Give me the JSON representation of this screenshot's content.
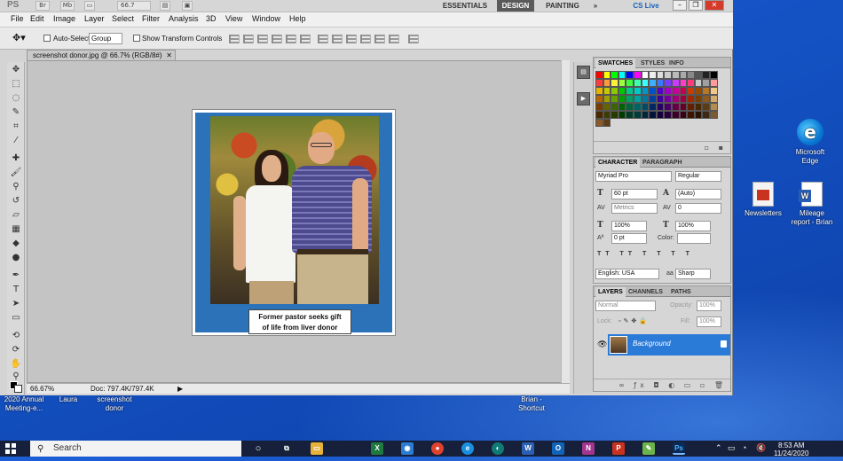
{
  "app": {
    "logo": "PS",
    "top_buttons": [
      "Br",
      "Mb"
    ],
    "zoom": "66.7",
    "workspaces": [
      "ESSENTIALS",
      "DESIGN",
      "PAINTING"
    ],
    "workspace_overflow": "»",
    "cs_live": "CS Live"
  },
  "menu": [
    "File",
    "Edit",
    "Image",
    "Layer",
    "Select",
    "Filter",
    "Analysis",
    "3D",
    "View",
    "Window",
    "Help"
  ],
  "options": {
    "auto_select_label": "Auto-Select:",
    "auto_select_value": "Group",
    "transform_label": "Show Transform Controls"
  },
  "document": {
    "tab_title": "screenshot donor.jpg @ 66.7% (RGB/8#)",
    "status_zoom": "66.67%",
    "status_doc": "Doc: 797.4K/797.4K",
    "caption_line1": "Former pastor seeks gift",
    "caption_line2": "of life from liver donor"
  },
  "panels": {
    "swatches_tabs": [
      "SWATCHES",
      "STYLES",
      "INFO"
    ],
    "character_tabs": [
      "CHARACTER",
      "PARAGRAPH"
    ],
    "font_family": "Myriad Pro",
    "font_style": "Regular",
    "font_size": "60 pt",
    "leading": "(Auto)",
    "kerning": "Metrics",
    "tracking": "0",
    "vscale": "100%",
    "hscale": "100%",
    "baseline": "0 pt",
    "color_label": "Color:",
    "language": "English: USA",
    "aa_label": "aa",
    "antialias": "Sharp",
    "layers_tabs": [
      "LAYERS",
      "CHANNELS",
      "PATHS"
    ],
    "blend_mode": "Normal",
    "opacity_label": "Opacity:",
    "opacity": "100%",
    "lock_label": "Lock:",
    "fill_label": "Fill:",
    "fill": "100%",
    "layer_name": "Background"
  },
  "desktop": {
    "edge_label_1": "Microsoft",
    "edge_label_2": "Edge",
    "newsletters": "Newsletters",
    "mileage_1": "Mileage",
    "mileage_2": "report - Brian",
    "bottom_1a": "2020 Annual",
    "bottom_1b": "Meeting-e...",
    "bottom_2": "Laura",
    "bottom_3a": "screenshot",
    "bottom_3b": "donor",
    "bottom_4a": "Brian -",
    "bottom_4b": "Shortcut"
  },
  "taskbar": {
    "search_placeholder": "Search",
    "time": "8:53 AM",
    "date": "11/24/2020"
  },
  "colors": {
    "desktop_blue": "#1452c4",
    "layer_selected": "#2a7ad8",
    "image_border_blue": "#2c72b8"
  }
}
